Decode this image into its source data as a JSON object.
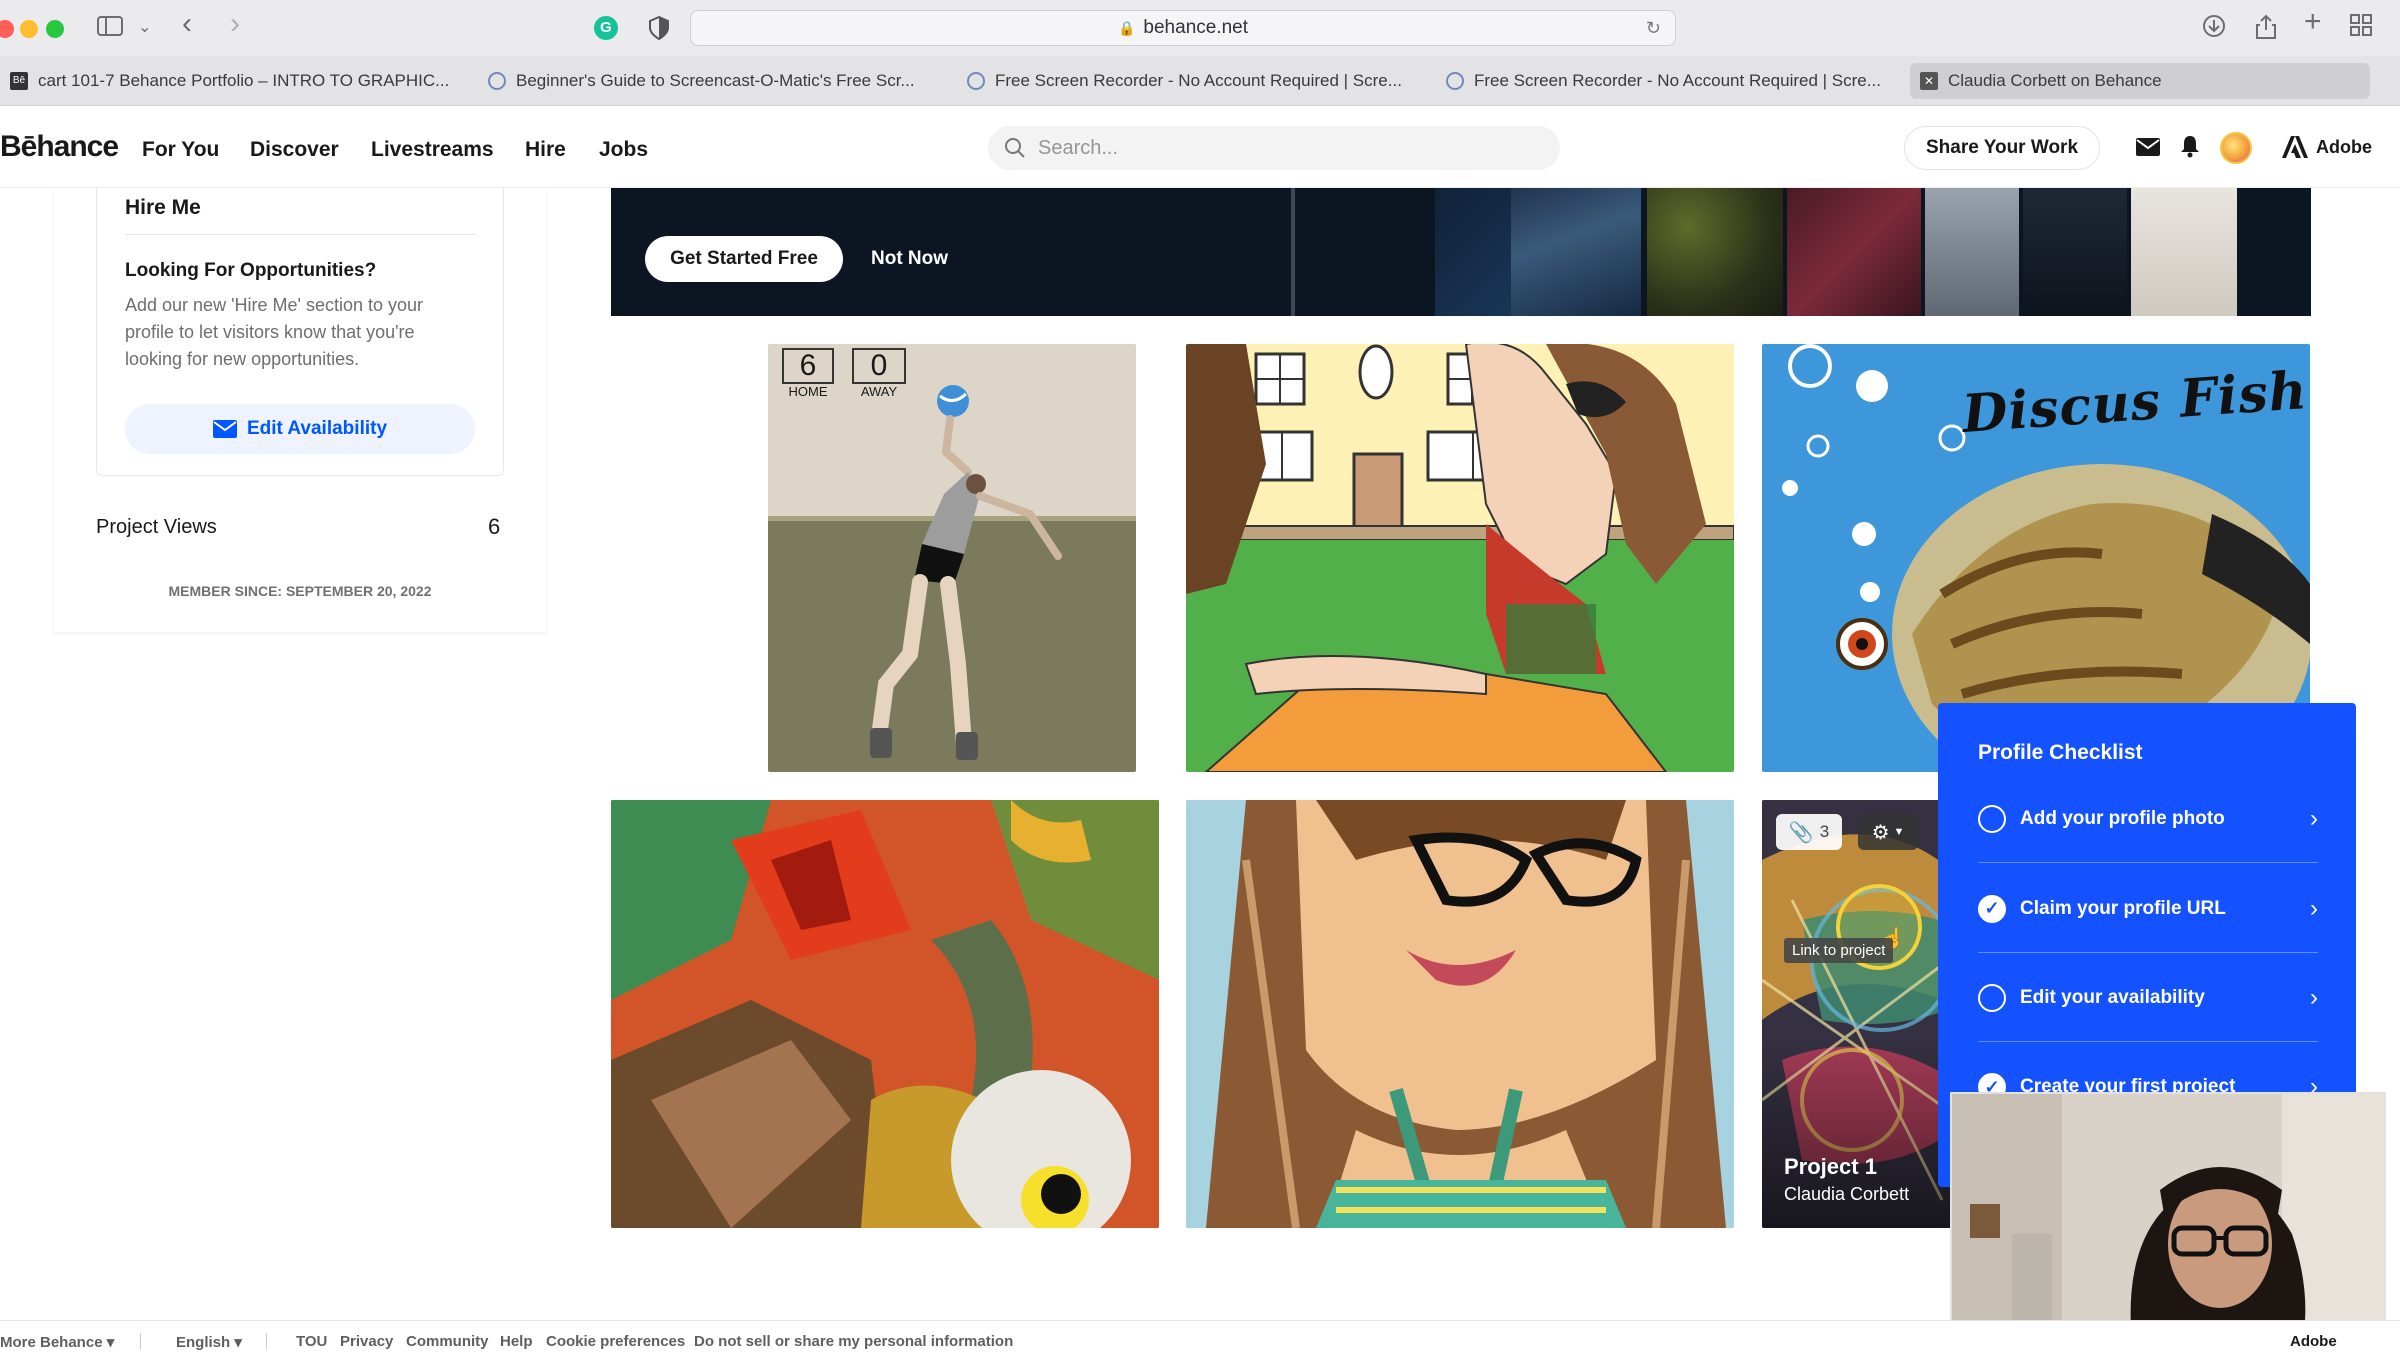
{
  "browser": {
    "url": "behance.net",
    "tabs": [
      {
        "label": "cart 101-7 Behance Portfolio – INTRO TO GRAPHIC..."
      },
      {
        "label": "Beginner's Guide to Screencast-O-Matic's Free Scr..."
      },
      {
        "label": "Free Screen Recorder - No Account Required | Scre..."
      },
      {
        "label": "Free Screen Recorder - No Account Required | Scre..."
      },
      {
        "label": "Claudia Corbett on Behance"
      }
    ]
  },
  "nav": {
    "logo": "Bēhance",
    "links": [
      "For You",
      "Discover",
      "Livestreams",
      "Hire",
      "Jobs"
    ],
    "search_placeholder": "Search...",
    "share_label": "Share Your Work",
    "adobe_label": "Adobe"
  },
  "sidebar": {
    "hire_title": "Hire Me",
    "opps_title": "Looking For Opportunities?",
    "opps_text": "Add our new 'Hire Me' section to your profile to let visitors know that you're looking for new opportunities.",
    "edit_label": "Edit Availability",
    "views_label": "Project Views",
    "views_value": "6",
    "member_since": "MEMBER SINCE: SEPTEMBER 20, 2022"
  },
  "banner": {
    "primary_label": "Get Started Free",
    "secondary_label": "Not Now"
  },
  "projects": {
    "scoreboard_home_value": "6",
    "scoreboard_home_label": "HOME",
    "scoreboard_away_value": "0",
    "scoreboard_away_label": "AWAY",
    "discus_title": "Discus Fish",
    "attachments_count": "3",
    "tooltip": "Link to project",
    "project_title": "Project 1",
    "project_owner": "Claudia Corbett"
  },
  "checklist": {
    "title": "Profile Checklist",
    "items": [
      {
        "label": "Add your profile photo",
        "done": false
      },
      {
        "label": "Claim your profile URL",
        "done": true
      },
      {
        "label": "Edit your availability",
        "done": false
      },
      {
        "label": "Create your first project",
        "done": true
      }
    ]
  },
  "footer": {
    "more": "More Behance ▾",
    "language": "English ▾",
    "links": [
      "TOU",
      "Privacy",
      "Community",
      "Help",
      "Cookie preferences",
      "Do not sell or share my personal information"
    ],
    "adobe": "Adobe"
  },
  "colors": {
    "accent": "#0057ff",
    "checklist_bg": "#1452ff",
    "banner_bg": "#0c1522"
  }
}
